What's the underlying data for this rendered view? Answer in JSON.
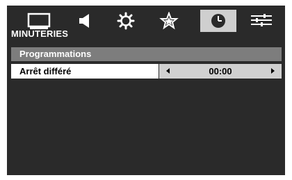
{
  "menu": {
    "title": "MINUTERIES",
    "tabs": [
      {
        "icon": "picture-icon",
        "active": false
      },
      {
        "icon": "speaker-icon",
        "active": false
      },
      {
        "icon": "gear-icon",
        "active": false
      },
      {
        "icon": "star-icon",
        "active": false
      },
      {
        "icon": "clock-icon",
        "active": true
      },
      {
        "icon": "settings-lines-icon",
        "active": false
      }
    ]
  },
  "section": {
    "label": "Programmations"
  },
  "rows": [
    {
      "label": "Arrêt différé",
      "value": "00:00"
    }
  ],
  "colors": {
    "background": "#2a2a2a",
    "active_tab": "#cfcfcf",
    "section_header": "#7d7d7d",
    "value_box": "#d0d0d0"
  }
}
